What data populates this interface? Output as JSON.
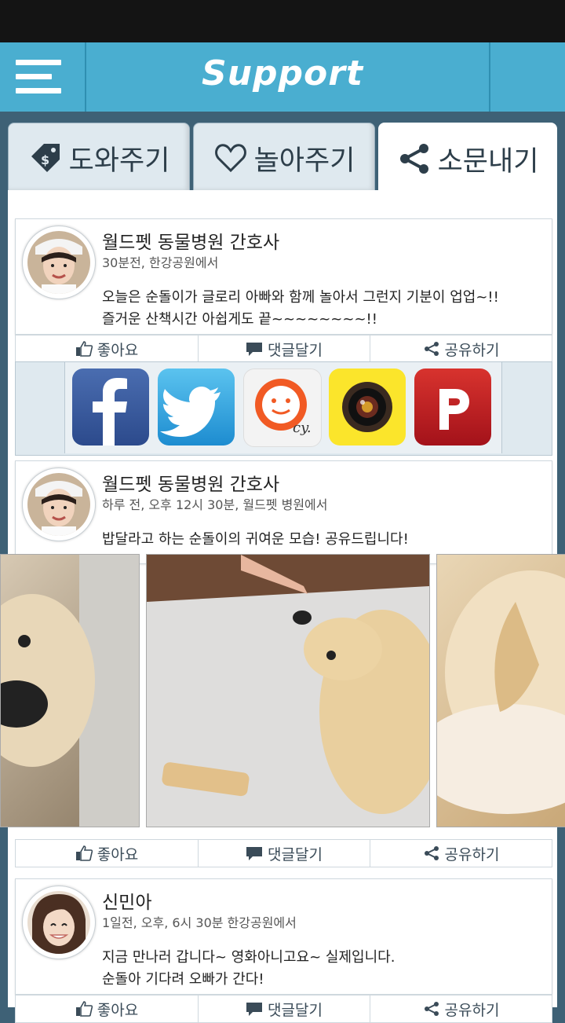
{
  "app": {
    "brand": "Support"
  },
  "tabs": [
    {
      "label": "도와주기",
      "icon": "price-tag-icon"
    },
    {
      "label": "놀아주기",
      "icon": "heart-icon"
    },
    {
      "label": "소문내기",
      "icon": "share-icon"
    }
  ],
  "posts": [
    {
      "author": "월드펫 동물병원 간호사",
      "meta": "30분전, 한강공원에서",
      "body": "오늘은 순돌이가 글로리 아빠와 함께 놀아서 그런지 기분이 업업~!!\n즐거운 산책시간 아쉽게도 끝~~~~~~~~!!"
    },
    {
      "author": "월드펫 동물병원 간호사",
      "meta": "하루 전, 오후 12시 30분, 월드펫 병원에서",
      "body": "밥달라고 하는 순돌이의 귀여운 모습! 공유드립니다!"
    },
    {
      "author": "신민아",
      "meta": "1일전, 오후, 6시 30분 한강공원에서",
      "body": "지금 만나러 갑니다~ 영화아니고요~ 실제입니다.\n순돌아 기다려 오빠가 간다!"
    }
  ],
  "actions": {
    "like": "좋아요",
    "comment": "댓글달기",
    "share": "공유하기"
  },
  "share_targets": [
    "facebook-icon",
    "twitter-icon",
    "cyworld-icon",
    "camera-app-icon",
    "path-icon"
  ],
  "colors": {
    "header": "#4aaed0",
    "tab_inactive": "#dfe9ef",
    "background": "#3e6176"
  }
}
